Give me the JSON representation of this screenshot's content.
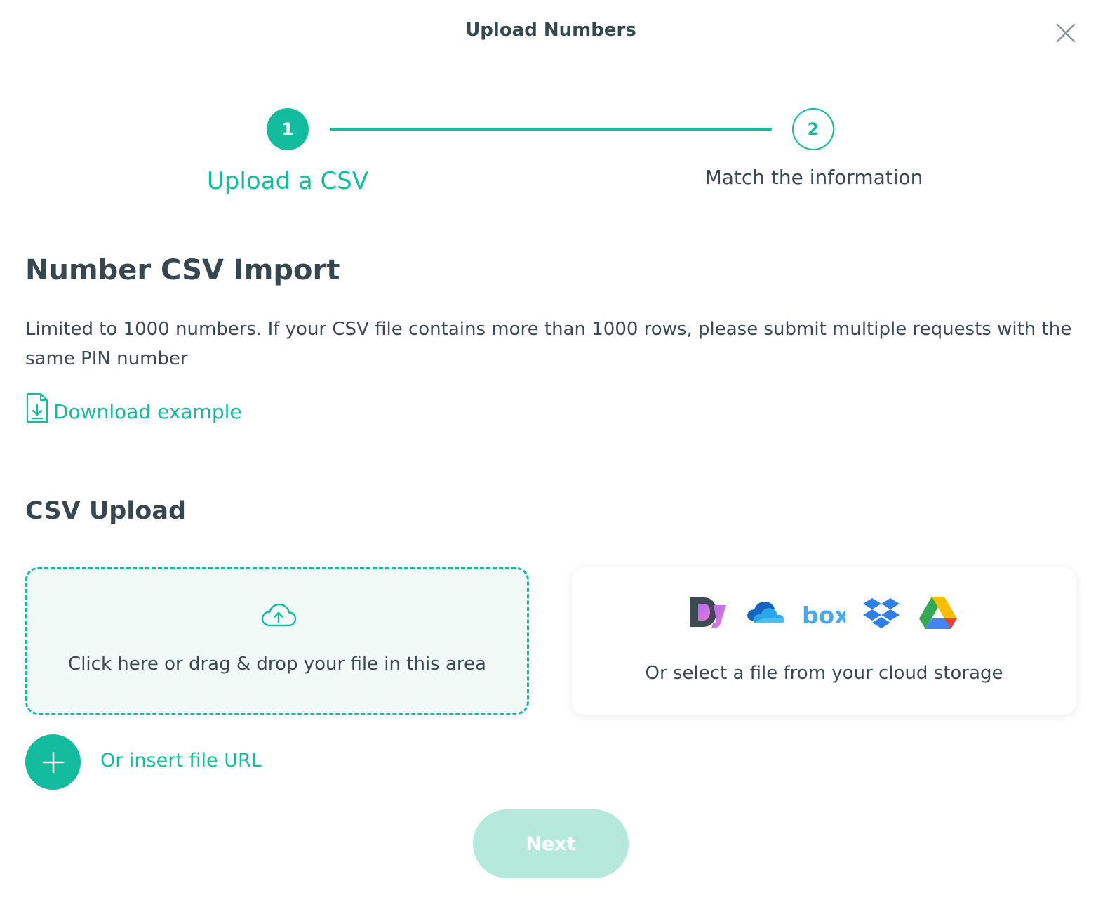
{
  "modal": {
    "title": "Upload Numbers"
  },
  "stepper": {
    "steps": [
      {
        "number": "1",
        "label": "Upload a CSV",
        "state": "active"
      },
      {
        "number": "2",
        "label": "Match the information",
        "state": "pending"
      }
    ]
  },
  "import_section": {
    "heading": "Number CSV Import",
    "description": "Limited to 1000 numbers. If your CSV file contains more than 1000 rows, please submit multiple requests with the same PIN number",
    "download_label": "Download example"
  },
  "upload_section": {
    "heading": "CSV Upload",
    "dropzone_text": "Click here or drag & drop your file in this area",
    "cloud_text": "Or select a file from your cloud storage",
    "providers": [
      "dj-icon",
      "onedrive-icon",
      "box-icon",
      "dropbox-icon",
      "google-drive-icon"
    ],
    "url_label": "Or insert file URL"
  },
  "actions": {
    "next_label": "Next"
  },
  "colors": {
    "accent": "#13bc9c",
    "next_disabled": "#b4e9db",
    "text": "#3b4a52"
  }
}
